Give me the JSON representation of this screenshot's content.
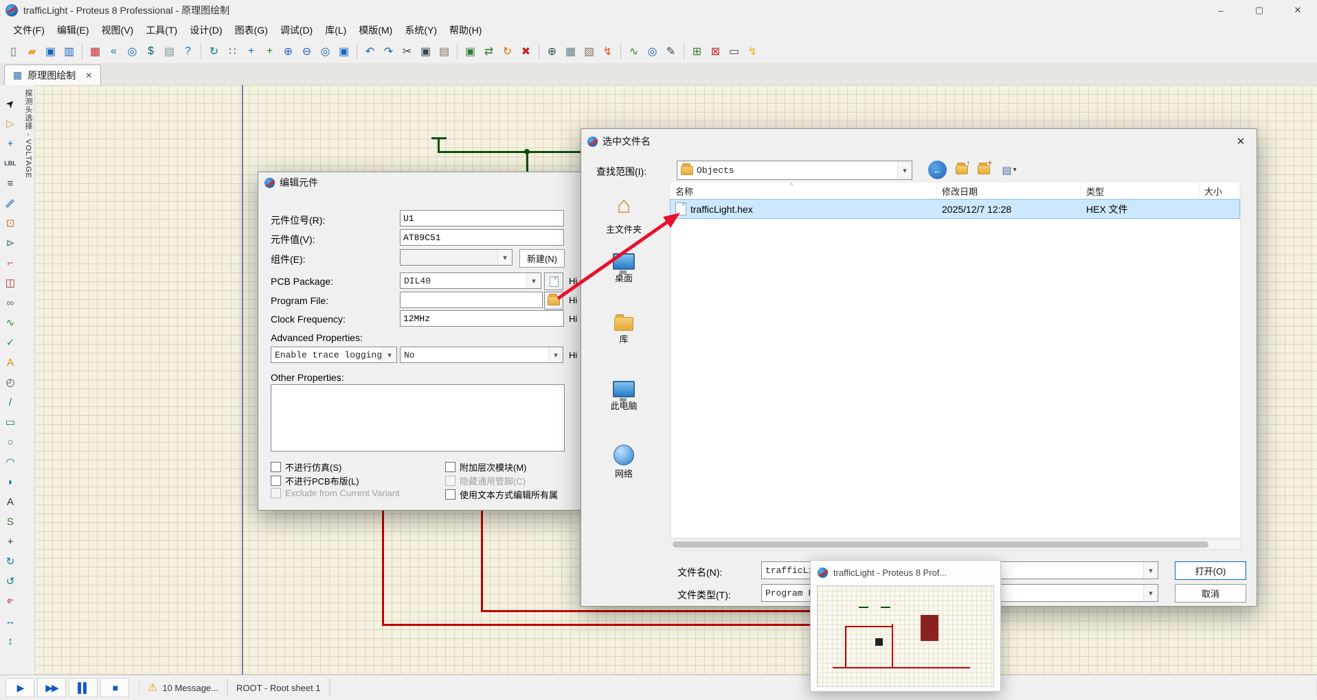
{
  "window": {
    "title": "trafficLight - Proteus 8 Professional - 原理图绘制",
    "minimize_glyph": "–",
    "maximize_glyph": "▢",
    "close_glyph": "✕"
  },
  "menu": {
    "items": [
      "文件(F)",
      "编辑(E)",
      "视图(V)",
      "工具(T)",
      "设计(D)",
      "图表(G)",
      "调试(D)",
      "库(L)",
      "模版(M)",
      "系统(Y)",
      "帮助(H)"
    ]
  },
  "toolbar": {
    "groups": [
      [
        {
          "name": "new-design",
          "glyph": "▯",
          "color": "#5a6b75"
        },
        {
          "name": "open-design",
          "glyph": "▰",
          "color": "#e8a33d"
        },
        {
          "name": "save-design",
          "glyph": "▣",
          "color": "#1565c0"
        },
        {
          "name": "import-design",
          "glyph": "▥",
          "color": "#1565c0"
        }
      ],
      [
        {
          "name": "schematic-capture",
          "glyph": "▦",
          "color": "#c62828"
        },
        {
          "name": "design-explorer",
          "glyph": "«",
          "color": "#00838f"
        },
        {
          "name": "find-component",
          "glyph": "◎",
          "color": "#1565c0"
        },
        {
          "name": "bill-of-materials",
          "glyph": "$",
          "color": "#00695c"
        },
        {
          "name": "project-notes",
          "glyph": "▤",
          "color": "#78909c"
        },
        {
          "name": "help",
          "glyph": "?",
          "color": "#1565c0"
        }
      ],
      [
        {
          "name": "redraw",
          "glyph": "↻",
          "color": "#00838f"
        },
        {
          "name": "toggle-grid",
          "glyph": "∷",
          "color": "#455a64"
        },
        {
          "name": "origin",
          "glyph": "+",
          "color": "#1565c0"
        },
        {
          "name": "pan-tool",
          "glyph": "+",
          "color": "#2e7d32"
        },
        {
          "name": "zoom-in",
          "glyph": "⊕",
          "color": "#1565c0"
        },
        {
          "name": "zoom-out",
          "glyph": "⊖",
          "color": "#1565c0"
        },
        {
          "name": "zoom-all",
          "glyph": "◎",
          "color": "#1565c0"
        },
        {
          "name": "zoom-area",
          "glyph": "▣",
          "color": "#1565c0"
        }
      ],
      [
        {
          "name": "undo",
          "glyph": "↶",
          "color": "#1565c0"
        },
        {
          "name": "redo",
          "glyph": "↷",
          "color": "#1565c0"
        },
        {
          "name": "cut",
          "glyph": "✂",
          "color": "#37474f"
        },
        {
          "name": "copy",
          "glyph": "▣",
          "color": "#37474f"
        },
        {
          "name": "paste",
          "glyph": "▤",
          "color": "#8d6e63"
        }
      ],
      [
        {
          "name": "block-copy",
          "glyph": "▣",
          "color": "#2e7d32"
        },
        {
          "name": "block-move",
          "glyph": "⇄",
          "color": "#2e7d32"
        },
        {
          "name": "block-rotate",
          "glyph": "↻",
          "color": "#ef6c00"
        },
        {
          "name": "block-delete",
          "glyph": "✖",
          "color": "#c62828"
        }
      ],
      [
        {
          "name": "pick-device",
          "glyph": "⊕",
          "color": "#37474f"
        },
        {
          "name": "make-device",
          "glyph": "▦",
          "color": "#607d8b"
        },
        {
          "name": "packaging-tool",
          "glyph": "▧",
          "color": "#8d6e63"
        },
        {
          "name": "decompose",
          "glyph": "↯",
          "color": "#e65100"
        }
      ],
      [
        {
          "name": "wire-autorouter",
          "glyph": "∿",
          "color": "#2e7d32"
        },
        {
          "name": "search-and-tag",
          "glyph": "◎",
          "color": "#1565c0"
        },
        {
          "name": "property-assignment",
          "glyph": "✎",
          "color": "#37474f"
        }
      ],
      [
        {
          "name": "new-sheet",
          "glyph": "⊞",
          "color": "#2e7d32"
        },
        {
          "name": "remove-sheet",
          "glyph": "⊠",
          "color": "#c62828"
        },
        {
          "name": "goto-sheet",
          "glyph": "▭",
          "color": "#37474f"
        },
        {
          "name": "electrical-rule-check",
          "glyph": "↯",
          "color": "#f9a825"
        }
      ]
    ]
  },
  "tab": {
    "label": "原理图绘制",
    "close_glyph": "✕",
    "icon_glyph": "▦"
  },
  "left_toolbar": {
    "caption": "探测头选择 - VOLTAGE",
    "tools": [
      {
        "name": "selection-tool",
        "glyph": "➤",
        "color": "#111111",
        "rot": -45
      },
      {
        "name": "component-mode",
        "glyph": "▷",
        "color": "#c99a2c"
      },
      {
        "name": "junction-mode",
        "glyph": "+",
        "color": "#1565c0"
      },
      {
        "name": "wire-label-mode",
        "glyph": "LBL",
        "color": "#37474f",
        "small": true
      },
      {
        "name": "text-script-mode",
        "glyph": "≡",
        "color": "#37474f"
      },
      {
        "name": "bus-mode",
        "glyph": "∥",
        "color": "#1565c0",
        "rot": 45
      },
      {
        "name": "subcircuit-mode",
        "glyph": "⊡",
        "color": "#cc7722"
      },
      {
        "name": "terminal-mode",
        "glyph": "⊳",
        "color": "#546e7a"
      },
      {
        "name": "device-pin-mode",
        "glyph": "⌐",
        "color": "#c0392b"
      },
      {
        "name": "graph-mode",
        "glyph": "◫",
        "color": "#b03030"
      },
      {
        "name": "tape-recorder-mode",
        "glyph": "∞",
        "color": "#546e7a"
      },
      {
        "name": "generator-mode",
        "glyph": "∿",
        "color": "#2e7d32"
      },
      {
        "name": "voltage-probe-mode",
        "glyph": "✓",
        "color": "#1b9e3a"
      },
      {
        "name": "current-probe-mode",
        "glyph": "A",
        "color": "#e08a00"
      },
      {
        "name": "virtual-instruments-mode",
        "glyph": "◴",
        "color": "#37474f"
      },
      {
        "name": "line-2d",
        "glyph": "/",
        "color": "#0a7a8a"
      },
      {
        "name": "box-2d",
        "glyph": "▭",
        "color": "#0a7a8a"
      },
      {
        "name": "circle-2d",
        "glyph": "○",
        "color": "#0a7a8a"
      },
      {
        "name": "arc-2d",
        "glyph": "◠",
        "color": "#0a7a8a"
      },
      {
        "name": "path-2d",
        "glyph": "◗",
        "color": "#0a7a8a"
      },
      {
        "name": "text-2d",
        "glyph": "A",
        "color": "#26323a"
      },
      {
        "name": "symbol-2d",
        "glyph": "S",
        "color": "#2e7d32"
      },
      {
        "name": "marker-2d",
        "glyph": "+",
        "color": "#26323a"
      },
      {
        "name": "rotate-cw",
        "glyph": "↻",
        "color": "#0a7a8a"
      },
      {
        "name": "rotate-ccw",
        "glyph": "↺",
        "color": "#0a7a8a"
      },
      {
        "name": "angle-readout",
        "glyph": "0°",
        "color": "#b03030",
        "small": true,
        "inter": false
      },
      {
        "name": "mirror-horizontal",
        "glyph": "↔",
        "color": "#0a7a8a"
      },
      {
        "name": "mirror-vertical",
        "glyph": "↕",
        "color": "#0a7a8a"
      }
    ]
  },
  "edit_dialog": {
    "title": "编辑元件",
    "fields": {
      "ref_label": "元件位号(R):",
      "ref_value": "U1",
      "val_label": "元件值(V):",
      "val_value": "AT89C51",
      "elem_label": "组件(E):",
      "elem_value": "",
      "new_button": "新建(N)",
      "pcb_label": "PCB Package:",
      "pcb_value": "DIL40",
      "prog_label": "Program File:",
      "prog_value": "",
      "clk_label": "Clock Frequency:",
      "clk_value": "12MHz",
      "adv_label": "Advanced Properties:",
      "adv_combo1": "Enable trace logging",
      "adv_combo2": "No",
      "other_label": "Other Properties:",
      "other_value": "",
      "hidden_fragment": "Hi"
    },
    "checkboxes": {
      "no_sim": "不进行仿真(S)",
      "no_pcb": "不进行PCB布版(L)",
      "exclude_variant": "Exclude from Current Variant",
      "attach_hierarchy": "附加层次模块(M)",
      "hide_common_pins": "隐藏通用管脚(C)",
      "edit_all_text": "使用文本方式编辑所有属"
    }
  },
  "file_dialog": {
    "title": "选中文件名",
    "close_glyph": "✕",
    "lookup_label": "查找范围(I):",
    "lookup_value": "Objects",
    "nav": {
      "back_glyph": "←",
      "up_glyph": "↑",
      "new_glyph": "+",
      "view_glyph": "▤",
      "view_arrow": "▾"
    },
    "places": [
      {
        "name": "place-home",
        "label": "主文件夹",
        "icon": "home"
      },
      {
        "name": "place-desktop",
        "label": "桌面",
        "icon": "monitor"
      },
      {
        "name": "place-library",
        "label": "库",
        "icon": "folder"
      },
      {
        "name": "place-computer",
        "label": "此电脑",
        "icon": "monitor"
      },
      {
        "name": "place-network",
        "label": "网络",
        "icon": "globe"
      }
    ],
    "columns": [
      "名称",
      "修改日期",
      "类型",
      "大小"
    ],
    "files": [
      {
        "name": "trafficLight.hex",
        "date": "2025/12/7 12:28",
        "type": "HEX 文件",
        "size": ""
      }
    ],
    "filename_label": "文件名(N):",
    "filename_value": "trafficLight.hex",
    "filetype_label": "文件类型(T):",
    "filetype_value": "Program Files",
    "open_button": "打开(O)",
    "cancel_button": "取消"
  },
  "preview_popup": {
    "title": "trafficLight - Proteus 8 Prof..."
  },
  "status_bar": {
    "sim_controls": [
      {
        "name": "play-button",
        "glyph": "▶"
      },
      {
        "name": "step-button",
        "glyph": "▶▶"
      },
      {
        "name": "pause-button",
        "glyph": "▌▌"
      },
      {
        "name": "stop-button",
        "glyph": "■"
      }
    ],
    "warning_glyph": "⚠",
    "messages": "10 Message...",
    "sheet": "ROOT - Root sheet 1"
  },
  "colors": {
    "annotation_red": "#e8112d",
    "wire_red": "#c00000",
    "wire_green": "#0e4d0e",
    "selection_blue": "#cce8ff"
  }
}
